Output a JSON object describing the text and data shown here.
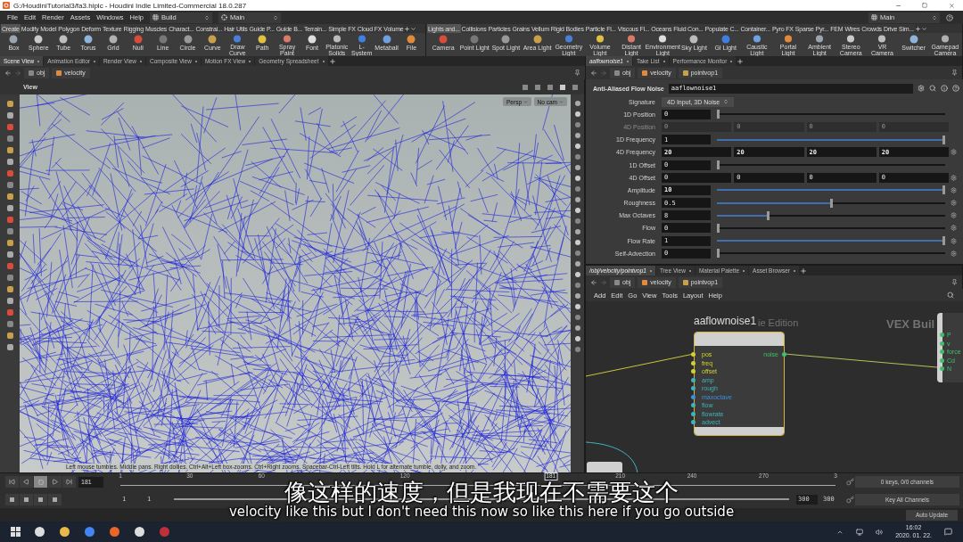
{
  "window": {
    "title": "G:/HoudiniTutorial3/fa3.hiplc - Houdini Indie Limited-Commercial 18.0.287"
  },
  "menu_bar": {
    "items": [
      "File",
      "Edit",
      "Render",
      "Assets",
      "Windows",
      "Help"
    ],
    "desktop": "Build",
    "layout": "Main",
    "right_desktop": "Main"
  },
  "shelves": [
    {
      "tabs": [
        {
          "label": "Create",
          "selected": true
        },
        {
          "label": "Modify",
          "selected": false
        },
        {
          "label": "Model",
          "selected": false
        },
        {
          "label": "Polygon",
          "selected": false
        },
        {
          "label": "Deform",
          "selected": false
        },
        {
          "label": "Texture",
          "selected": false
        },
        {
          "label": "Rigging",
          "selected": false
        },
        {
          "label": "Muscles",
          "selected": false
        },
        {
          "label": "Charact...",
          "selected": false
        },
        {
          "label": "Constrai...",
          "selected": false
        },
        {
          "label": "Hair Utils",
          "selected": false
        },
        {
          "label": "Guide P...",
          "selected": false
        },
        {
          "label": "Guide B...",
          "selected": false
        },
        {
          "label": "Terrain...",
          "selected": false
        },
        {
          "label": "Simple FX",
          "selected": false
        },
        {
          "label": "Cloud FX",
          "selected": false
        },
        {
          "label": "Volume",
          "selected": false
        }
      ],
      "tools": [
        "Box",
        "Sphere",
        "Tube",
        "Torus",
        "Grid",
        "Null",
        "Line",
        "Circle",
        "Curve",
        "Draw Curve",
        "Path",
        "Spray Paint",
        "Font",
        "Platonic Solids",
        "L-System",
        "Metaball",
        "File"
      ]
    },
    {
      "tabs": [
        {
          "label": "Lights and...",
          "selected": true
        },
        {
          "label": "Collisions",
          "selected": false
        },
        {
          "label": "Particles",
          "selected": false
        },
        {
          "label": "Grains",
          "selected": false
        },
        {
          "label": "Vellum",
          "selected": false
        },
        {
          "label": "Rigid Bodies",
          "selected": false
        },
        {
          "label": "Particle Fl...",
          "selected": false
        },
        {
          "label": "Viscous Fl...",
          "selected": false
        },
        {
          "label": "Oceans",
          "selected": false
        },
        {
          "label": "Fluid Con...",
          "selected": false
        },
        {
          "label": "Populate C...",
          "selected": false
        },
        {
          "label": "Container...",
          "selected": false
        },
        {
          "label": "Pyro FX",
          "selected": false
        },
        {
          "label": "Sparse Pyr...",
          "selected": false
        },
        {
          "label": "FEM",
          "selected": false
        },
        {
          "label": "Wires",
          "selected": false
        },
        {
          "label": "Crowds",
          "selected": false
        },
        {
          "label": "Drive Sim...",
          "selected": false
        }
      ],
      "tools": [
        "Camera",
        "Point Light",
        "Spot Light",
        "Area Light",
        "Geometry Light",
        "Volume Light",
        "Distant Light",
        "Environment Light",
        "Sky Light",
        "GI Light",
        "Caustic Light",
        "Portal Light",
        "Ambient Light",
        "Stereo Camera",
        "VR Camera",
        "Switcher",
        "Gamepad Camera"
      ]
    }
  ],
  "scene_pane": {
    "tabs": [
      {
        "label": "Scene View",
        "selected": true
      },
      {
        "label": "Animation Editor",
        "selected": false
      },
      {
        "label": "Render View",
        "selected": false
      },
      {
        "label": "Composite View",
        "selected": false
      },
      {
        "label": "Motion FX View",
        "selected": false
      },
      {
        "label": "Geometry Spreadsheet",
        "selected": false
      }
    ],
    "path": [
      "obj",
      "velocity"
    ],
    "viewport": {
      "title": "View",
      "camera": "Persp",
      "camera_menu": "No cam",
      "hint": "Left mouse tumbles. Middle pans. Right dollies. Ctrl+Alt+Left box-zooms. Ctrl+Right zooms. Spacebar-Ctrl-Left tilts. Hold L for alternate tumble, dolly, and zoom."
    }
  },
  "parameter_pane": {
    "tabs": [
      {
        "label": "aaflownoise1",
        "selected": true
      },
      {
        "label": "Take List",
        "selected": false
      },
      {
        "label": "Performance Monitor",
        "selected": false
      }
    ],
    "path": [
      "obj",
      "velocity",
      "pointvop1"
    ],
    "node_type": "Anti-Aliased Flow Noise",
    "node_name": "aaflownoise1",
    "rows": [
      {
        "label": "Signature",
        "kind": "menu",
        "value": "4D Input, 3D Noise",
        "disabled": false,
        "changed": false,
        "gear": false
      },
      {
        "label": "1D Position",
        "kind": "slider",
        "value": "0",
        "level": 0,
        "disabled": false,
        "changed": false,
        "gear": false
      },
      {
        "label": "4D Position",
        "kind": "vector",
        "values": [
          "0",
          "0",
          "0",
          "0"
        ],
        "disabled": true,
        "changed": false,
        "gear": false
      },
      {
        "label": "1D Frequency",
        "kind": "slider",
        "value": "1",
        "level": 1,
        "disabled": false,
        "changed": false,
        "gear": false
      },
      {
        "label": "4D Frequency",
        "kind": "vector",
        "values": [
          "20",
          "20",
          "20",
          "20"
        ],
        "disabled": false,
        "changed": true,
        "gear": true
      },
      {
        "label": "1D Offset",
        "kind": "slider",
        "value": "0",
        "level": 0,
        "disabled": false,
        "changed": false,
        "gear": false
      },
      {
        "label": "4D Offset",
        "kind": "vector",
        "values": [
          "0",
          "0",
          "0",
          "0"
        ],
        "disabled": false,
        "changed": false,
        "gear": true
      },
      {
        "label": "Amplitude",
        "kind": "slider",
        "value": "10",
        "level": 1,
        "disabled": false,
        "changed": true,
        "gear": true
      },
      {
        "label": "Roughness",
        "kind": "slider",
        "value": "0.5",
        "level": 0.5,
        "disabled": false,
        "changed": false,
        "gear": true
      },
      {
        "label": "Max Octaves",
        "kind": "slider",
        "value": "8",
        "level": 0.22,
        "disabled": false,
        "changed": false,
        "gear": true
      },
      {
        "label": "Flow",
        "kind": "slider",
        "value": "0",
        "level": 0,
        "disabled": false,
        "changed": false,
        "gear": true
      },
      {
        "label": "Flow Rate",
        "kind": "slider",
        "value": "1",
        "level": 1,
        "disabled": false,
        "changed": false,
        "gear": true
      },
      {
        "label": "Self-Advection",
        "kind": "slider",
        "value": "0",
        "level": 0,
        "disabled": false,
        "changed": false,
        "gear": true
      }
    ]
  },
  "network_pane": {
    "tabs": [
      {
        "label": "/obj/velocity/pointvop1",
        "selected": true
      },
      {
        "label": "Tree View",
        "selected": false
      },
      {
        "label": "Material Palette",
        "selected": false
      },
      {
        "label": "Asset Browser",
        "selected": false
      }
    ],
    "path": [
      "obj",
      "velocity",
      "pointvop1"
    ],
    "menu": [
      "Add",
      "Edit",
      "Go",
      "View",
      "Tools",
      "Layout",
      "Help"
    ],
    "background_labels": [
      "ie Edition",
      "VEX Buil"
    ],
    "node": {
      "name": "aaflownoise1",
      "inputs": [
        {
          "name": "pos",
          "color": "#d4d22a"
        },
        {
          "name": "freq",
          "color": "#d4d22a"
        },
        {
          "name": "offset",
          "color": "#d4d22a"
        },
        {
          "name": "amp",
          "color": "#3cb4bc"
        },
        {
          "name": "rough",
          "color": "#3cb4bc"
        },
        {
          "name": "maxoctave",
          "color": "#3d8fd8"
        },
        {
          "name": "flow",
          "color": "#3cb4bc"
        },
        {
          "name": "flowrate",
          "color": "#3cb4bc"
        },
        {
          "name": "advect",
          "color": "#3cb4bc"
        }
      ],
      "outputs": [
        {
          "name": "noise",
          "color": "#3fbf6b"
        }
      ]
    },
    "output_node": {
      "inputs": [
        {
          "name": "P",
          "color": "#3fbf6b"
        },
        {
          "name": "v",
          "color": "#3fbf6b"
        },
        {
          "name": "force",
          "color": "#3fbf6b"
        },
        {
          "name": "Cd",
          "color": "#3fbf6b"
        },
        {
          "name": "N",
          "color": "#3fbf6b"
        }
      ]
    }
  },
  "timeline": {
    "frame": "181",
    "ruler_labels": [
      "1",
      "30",
      "60",
      "120",
      "210",
      "240",
      "270",
      "3"
    ],
    "playhead": {
      "label": "181",
      "level": 0.602
    },
    "start": "1",
    "range_start": "1",
    "range_end": "300",
    "end": "300",
    "keys": "0 keys, 0/0 channels",
    "key_button": "Key All Channels",
    "update_mode": "Auto Update"
  },
  "subtitles": {
    "zh": "像这样的速度，但是我现在不需要这个",
    "en": "velocity like this but I don't need this now so like this here if you go outside"
  },
  "taskbar": {
    "time": "16:02",
    "date": "2020. 01. 22."
  }
}
